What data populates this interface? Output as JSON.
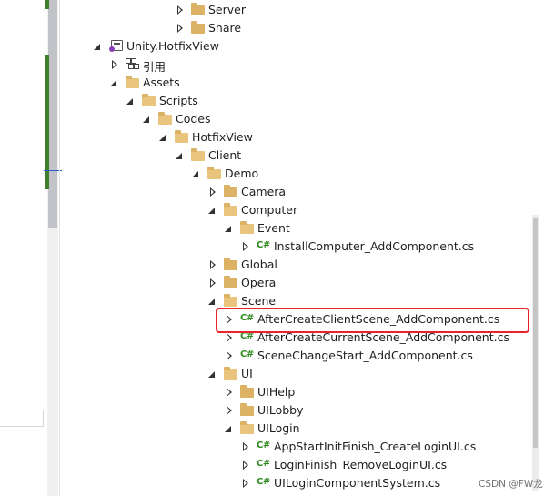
{
  "tree": {
    "rows": [
      {
        "label": "Server",
        "kind": "folder",
        "state": "collapsed"
      },
      {
        "label": "Share",
        "kind": "folder",
        "state": "collapsed"
      },
      {
        "label": "Unity.HotfixView",
        "kind": "project",
        "state": "expanded"
      },
      {
        "label": "引用",
        "kind": "references",
        "state": "collapsed"
      },
      {
        "label": "Assets",
        "kind": "folder",
        "state": "expanded"
      },
      {
        "label": "Scripts",
        "kind": "folder",
        "state": "expanded"
      },
      {
        "label": "Codes",
        "kind": "folder",
        "state": "expanded"
      },
      {
        "label": "HotfixView",
        "kind": "folder",
        "state": "expanded"
      },
      {
        "label": "Client",
        "kind": "folder",
        "state": "expanded"
      },
      {
        "label": "Demo",
        "kind": "folder",
        "state": "expanded"
      },
      {
        "label": "Camera",
        "kind": "folder",
        "state": "collapsed"
      },
      {
        "label": "Computer",
        "kind": "folder",
        "state": "expanded"
      },
      {
        "label": "Event",
        "kind": "folder",
        "state": "expanded"
      },
      {
        "label": "InstallComputer_AddComponent.cs",
        "kind": "cs",
        "state": "collapsed"
      },
      {
        "label": "Global",
        "kind": "folder",
        "state": "collapsed"
      },
      {
        "label": "Opera",
        "kind": "folder",
        "state": "collapsed"
      },
      {
        "label": "Scene",
        "kind": "folder",
        "state": "expanded"
      },
      {
        "label": "AfterCreateClientScene_AddComponent.cs",
        "kind": "cs",
        "state": "collapsed"
      },
      {
        "label": "AfterCreateCurrentScene_AddComponent.cs",
        "kind": "cs",
        "state": "collapsed"
      },
      {
        "label": "SceneChangeStart_AddComponent.cs",
        "kind": "cs",
        "state": "collapsed"
      },
      {
        "label": "UI",
        "kind": "folder",
        "state": "expanded"
      },
      {
        "label": "UIHelp",
        "kind": "folder",
        "state": "collapsed"
      },
      {
        "label": "UILobby",
        "kind": "folder",
        "state": "collapsed"
      },
      {
        "label": "UILogin",
        "kind": "folder",
        "state": "expanded"
      },
      {
        "label": "AppStartInitFinish_CreateLoginUI.cs",
        "kind": "cs",
        "state": "collapsed"
      },
      {
        "label": "LoginFinish_RemoveLoginUI.cs",
        "kind": "cs",
        "state": "collapsed"
      },
      {
        "label": "UILoginComponentSystem.cs",
        "kind": "cs",
        "state": "collapsed"
      }
    ],
    "cs_badge": "C#",
    "highlighted_item": "AfterCreateClientScene_AddComponent.cs"
  },
  "watermark": "CSDN @FW龙",
  "colors": {
    "highlight_border": "#e8232a",
    "folder": "#dcb264",
    "cs_icon": "#2e8b1f",
    "change_bar": "#3f7f2a"
  }
}
